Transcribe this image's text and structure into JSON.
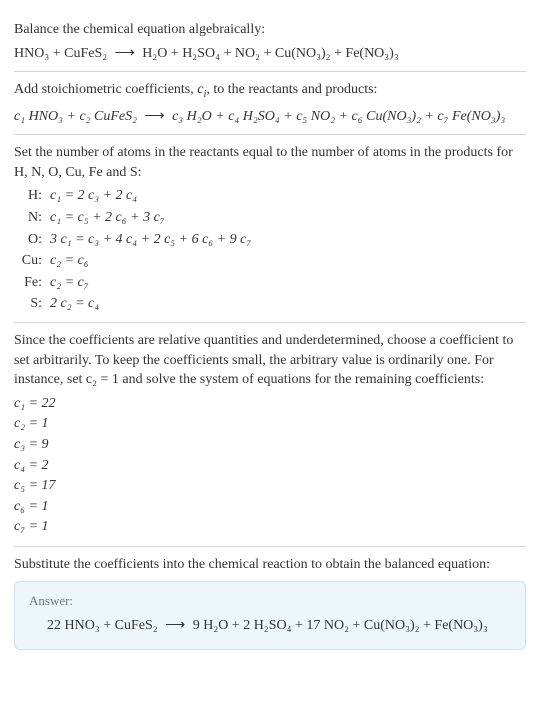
{
  "sec1": {
    "label": "Balance the chemical equation algebraically:",
    "lhs": "HNO₃ + CuFeS₂",
    "arrow": "⟶",
    "rhs": "H₂O + H₂SO₄ + NO₂ + Cu(NO₃)₂ + Fe(NO₃)₃"
  },
  "sec2": {
    "label_a": "Add stoichiometric coefficients, ",
    "label_ci": "c",
    "label_i": "i",
    "label_b": ", to the reactants and products:",
    "lhs": "c₁ HNO₃ + c₂ CuFeS₂",
    "arrow": "⟶",
    "rhs": "c₃ H₂O + c₄ H₂SO₄ + c₅ NO₂ + c₆ Cu(NO₃)₂ + c₇ Fe(NO₃)₃"
  },
  "sec3": {
    "label": "Set the number of atoms in the reactants equal to the number of atoms in the products for H, N, O, Cu, Fe and S:",
    "rows": [
      {
        "el": "H:",
        "eq": "c₁ = 2 c₃ + 2 c₄"
      },
      {
        "el": "N:",
        "eq": "c₁ = c₅ + 2 c₆ + 3 c₇"
      },
      {
        "el": "O:",
        "eq": "3 c₁ = c₃ + 4 c₄ + 2 c₅ + 6 c₆ + 9 c₇"
      },
      {
        "el": "Cu:",
        "eq": "c₂ = c₆"
      },
      {
        "el": "Fe:",
        "eq": "c₂ = c₇"
      },
      {
        "el": "S:",
        "eq": "2 c₂ = c₄"
      }
    ]
  },
  "sec4": {
    "label": "Since the coefficients are relative quantities and underdetermined, choose a coefficient to set arbitrarily. To keep the coefficients small, the arbitrary value is ordinarily one. For instance, set c₂ = 1 and solve the system of equations for the remaining coefficients:",
    "coeffs": [
      "c₁ = 22",
      "c₂ = 1",
      "c₃ = 9",
      "c₄ = 2",
      "c₅ = 17",
      "c₆ = 1",
      "c₇ = 1"
    ]
  },
  "sec5": {
    "label": "Substitute the coefficients into the chemical reaction to obtain the balanced equation:"
  },
  "answer": {
    "label": "Answer:",
    "lhs": "22 HNO₃ + CuFeS₂",
    "arrow": "⟶",
    "rhs": "9 H₂O + 2 H₂SO₄ + 17 NO₂ + Cu(NO₃)₂ + Fe(NO₃)₃"
  }
}
